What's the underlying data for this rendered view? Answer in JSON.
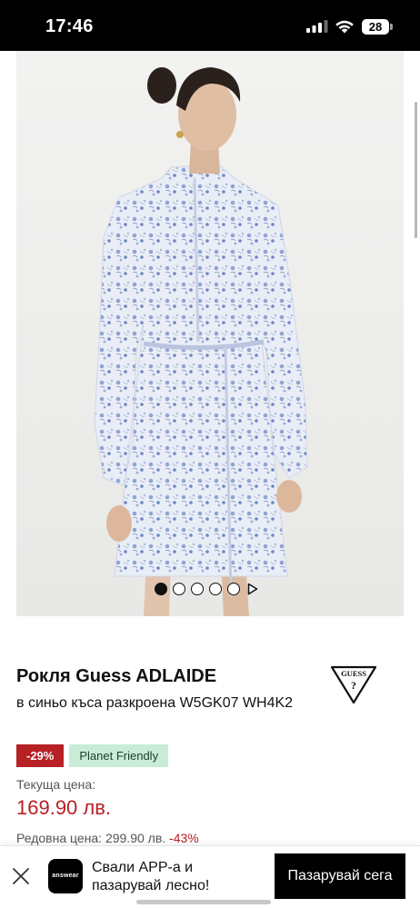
{
  "status_bar": {
    "time": "17:46",
    "battery_level": "28",
    "icons": [
      "signal-icon",
      "wifi-icon",
      "battery-icon"
    ]
  },
  "gallery": {
    "image_description_icon": "dress-photo",
    "total_slides": 5,
    "active_slide": 1,
    "has_video": true
  },
  "product": {
    "title": "Рокля Guess ADLAIDE",
    "subtitle": "в синьо къса разкроена W5GK07 WH4K2",
    "brand_logo_icon": "guess-logo-icon",
    "badges": {
      "discount": "-29%",
      "eco": "Planet Friendly"
    },
    "price_label": "Текуща цена:",
    "current_price": "169.90 лв.",
    "regular_price_text": "Редовна цена: 299.90 лв.",
    "regular_discount": "-43%"
  },
  "app_banner": {
    "logo_text": "answear",
    "text": "Свали APP-а и пазарувай лесно!",
    "cta_label": "Пазарувай сега"
  },
  "colors": {
    "accent_red": "#b72025",
    "eco_green": "#c9ecd7",
    "black": "#000000"
  }
}
